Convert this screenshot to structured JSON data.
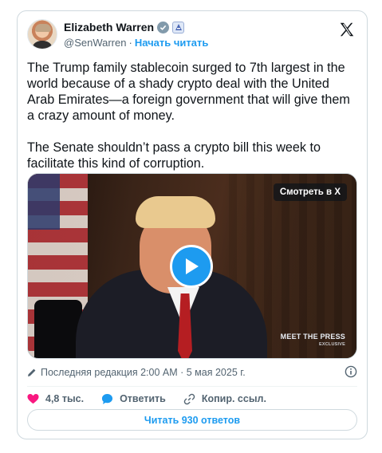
{
  "author": {
    "name": "Elizabeth Warren",
    "handle": "@SenWarren",
    "separator": "·",
    "follow_label": "Начать читать"
  },
  "icons": {
    "verified": "verified-badge-icon",
    "government": "government-badge-icon",
    "platform": "x-logo-icon",
    "edit": "pencil-icon",
    "info": "info-icon",
    "like": "heart-icon",
    "reply": "speech-bubble-icon",
    "link": "link-icon",
    "play": "play-icon"
  },
  "tweet": {
    "paragraph1": "The Trump family stablecoin surged to 7th largest in the world because of a shady crypto deal with the United Arab Emirates—a foreign government that will give them a crazy amount of money.",
    "paragraph2": "The Senate shouldn’t pass a crypto bill this week to facilitate this kind of corruption."
  },
  "media": {
    "watch_label": "Смотреть в X",
    "logo_text": "MEET THE PRESS",
    "logo_sub": "EXCLUSIVE"
  },
  "meta": {
    "edited_text": "Последняя редакция 2:00 AM · 5 мая 2025 г."
  },
  "actions": {
    "likes": "4,8 тыс.",
    "reply_label": "Ответить",
    "copy_link_label": "Копир. ссыл."
  },
  "replies_button": "Читать 930 ответов",
  "colors": {
    "accent": "#1d9bf0",
    "like": "#f91880",
    "text": "#0f1419",
    "secondary": "#536471",
    "border": "#cfd9de"
  }
}
